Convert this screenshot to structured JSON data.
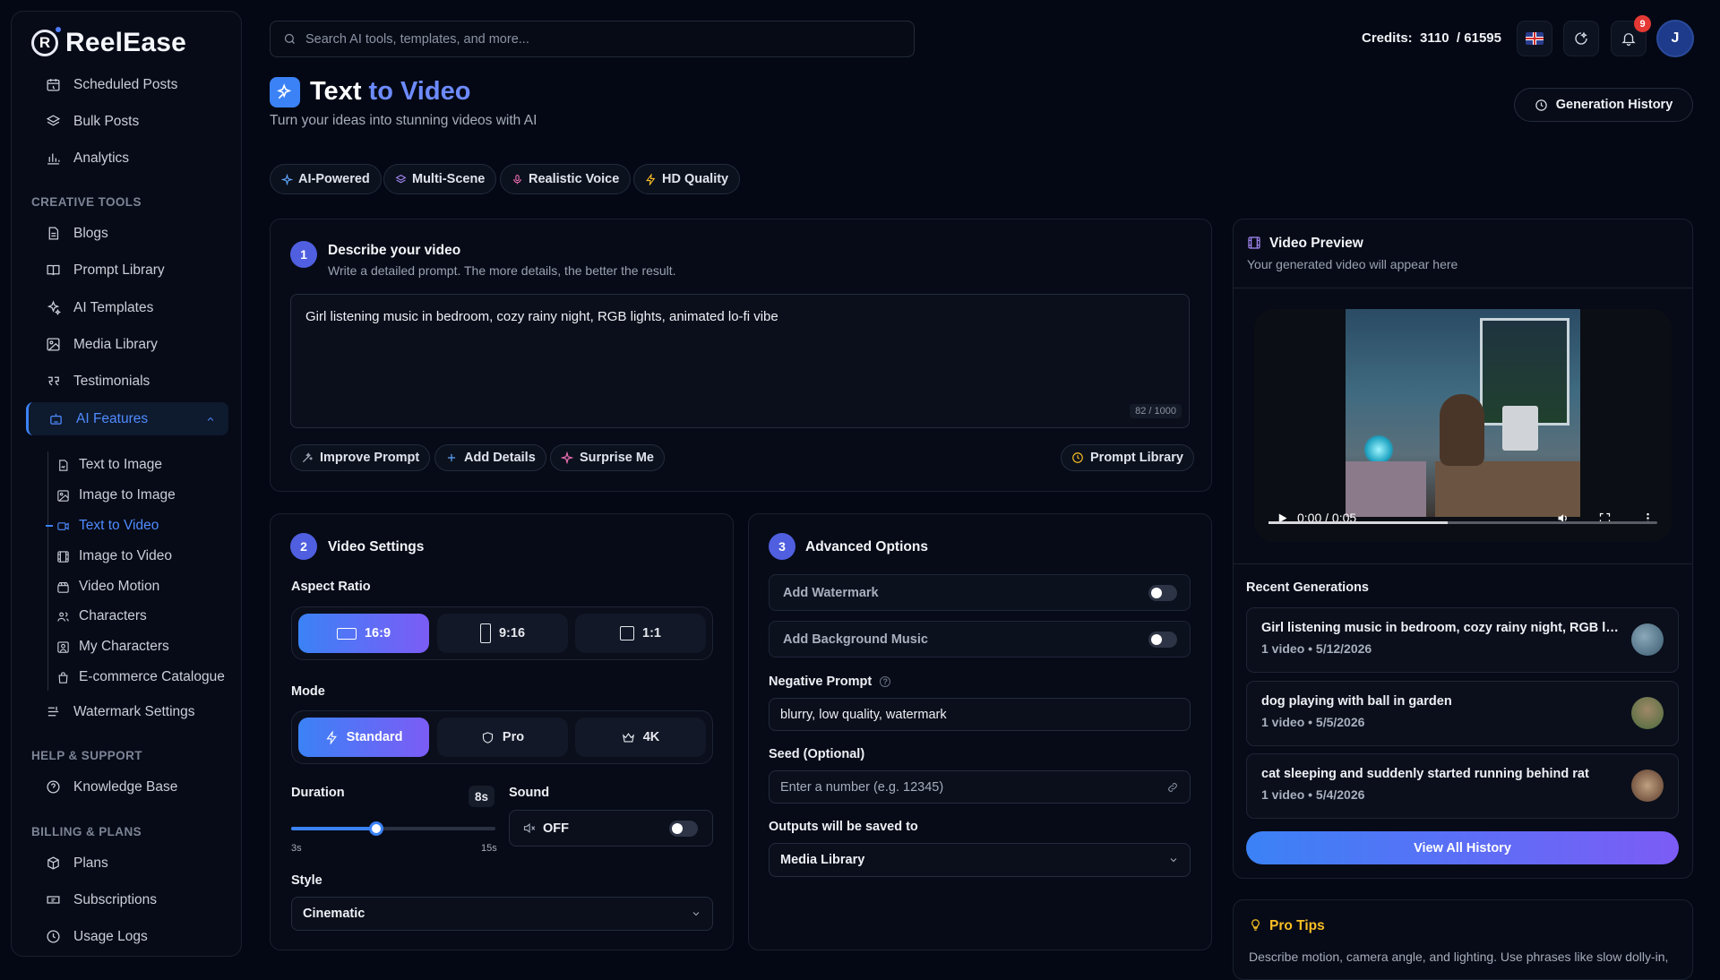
{
  "app": {
    "name": "ReelEase",
    "logo_letter": "R"
  },
  "sidebar": {
    "top_items": [
      {
        "label": "Scheduled Posts",
        "icon": "calendar-clock-icon"
      },
      {
        "label": "Bulk Posts",
        "icon": "layers-icon"
      },
      {
        "label": "Analytics",
        "icon": "bar-chart-icon"
      }
    ],
    "section_creative": "CREATIVE TOOLS",
    "creative_items": [
      {
        "label": "Blogs",
        "icon": "file-text-icon"
      },
      {
        "label": "Prompt Library",
        "icon": "book-open-icon"
      },
      {
        "label": "AI Templates",
        "icon": "sparkles-icon"
      },
      {
        "label": "Media Library",
        "icon": "image-icon"
      },
      {
        "label": "Testimonials",
        "icon": "quote-icon"
      },
      {
        "label": "AI Features",
        "icon": "robot-icon"
      }
    ],
    "ai_sub_items": [
      {
        "label": "Text to Image",
        "icon": "file-image-icon"
      },
      {
        "label": "Image to Image",
        "icon": "image-icon"
      },
      {
        "label": "Text to Video",
        "icon": "video-icon"
      },
      {
        "label": "Image to Video",
        "icon": "film-icon"
      },
      {
        "label": "Video Motion",
        "icon": "clapperboard-icon"
      },
      {
        "label": "Characters",
        "icon": "users-icon"
      },
      {
        "label": "My Characters",
        "icon": "image-user-icon"
      },
      {
        "label": "E-commerce Catalogue",
        "icon": "shopping-bag-icon"
      }
    ],
    "watermark_item": {
      "label": "Watermark Settings",
      "icon": "text-align-icon"
    },
    "section_help": "HELP & SUPPORT",
    "help_items": [
      {
        "label": "Knowledge Base",
        "icon": "help-circle-icon"
      }
    ],
    "section_billing": "BILLING & PLANS",
    "billing_items": [
      {
        "label": "Plans",
        "icon": "package-icon"
      },
      {
        "label": "Subscriptions",
        "icon": "ticket-icon"
      },
      {
        "label": "Usage Logs",
        "icon": "clock-icon"
      }
    ]
  },
  "header": {
    "search_placeholder": "Search AI tools, templates, and more...",
    "credits_label": "Credits:",
    "credits_used": "3110",
    "credits_total": "/ 61595",
    "notification_count": "9",
    "avatar_initial": "J"
  },
  "page": {
    "title_main": "Text",
    "title_accent": "to Video",
    "subtitle": "Turn your ideas into stunning videos with AI",
    "history_button": "Generation History",
    "chips": [
      {
        "label": "AI-Powered",
        "color": "#60a5fa"
      },
      {
        "label": "Multi-Scene",
        "color": "#a78bfa"
      },
      {
        "label": "Realistic Voice",
        "color": "#f472b6"
      },
      {
        "label": "HD Quality",
        "color": "#fbbf24"
      }
    ]
  },
  "describe": {
    "step": "1",
    "title": "Describe your video",
    "subtitle": "Write a detailed prompt. The more details, the better the result.",
    "prompt": "Girl listening music in bedroom, cozy rainy night, RGB lights, animated lo-fi vibe",
    "counter": "82 / 1000",
    "improve": "Improve Prompt",
    "add_details": "Add Details",
    "surprise": "Surprise Me",
    "library": "Prompt Library"
  },
  "settings": {
    "step": "2",
    "title": "Video Settings",
    "aspect_label": "Aspect Ratio",
    "aspect_options": [
      "16:9",
      "9:16",
      "1:1"
    ],
    "aspect_selected": "16:9",
    "mode_label": "Mode",
    "mode_options": [
      "Standard",
      "Pro",
      "4K"
    ],
    "mode_selected": "Standard",
    "duration_label": "Duration",
    "duration_value": "8s",
    "duration_seconds": 8,
    "duration_min": "3s",
    "duration_max": "15s",
    "sound_label": "Sound",
    "sound_value": "OFF",
    "style_label": "Style",
    "style_value": "Cinematic"
  },
  "advanced": {
    "step": "3",
    "title": "Advanced Options",
    "watermark": "Add Watermark",
    "bg_music": "Add Background Music",
    "negative_label": "Negative Prompt",
    "negative_value": "blurry, low quality, watermark",
    "seed_label": "Seed (Optional)",
    "seed_placeholder": "Enter a number (e.g. 12345)",
    "output_label": "Outputs will be saved to",
    "output_value": "Media Library"
  },
  "preview": {
    "title": "Video Preview",
    "subtitle": "Your generated video will appear here",
    "time": "0:00 / 0:05",
    "progress": 0.46
  },
  "recent": {
    "title": "Recent Generations",
    "items": [
      {
        "title": "Girl listening music in bedroom, cozy rainy night, RGB lights, animated lo-fi vibe",
        "meta": "1 video • 5/12/2026",
        "thumb": "#4a6a80"
      },
      {
        "title": "dog playing with ball in garden",
        "meta": "1 video • 5/5/2026",
        "thumb": "#6a7a4a"
      },
      {
        "title": "cat sleeping and suddenly started running behind rat",
        "meta": "1 video • 5/4/2026",
        "thumb": "#7a5a4a"
      }
    ],
    "view_all": "View All History"
  },
  "tips": {
    "title": "Pro Tips",
    "text": "Describe motion, camera angle, and lighting. Use phrases like slow dolly-in,"
  }
}
